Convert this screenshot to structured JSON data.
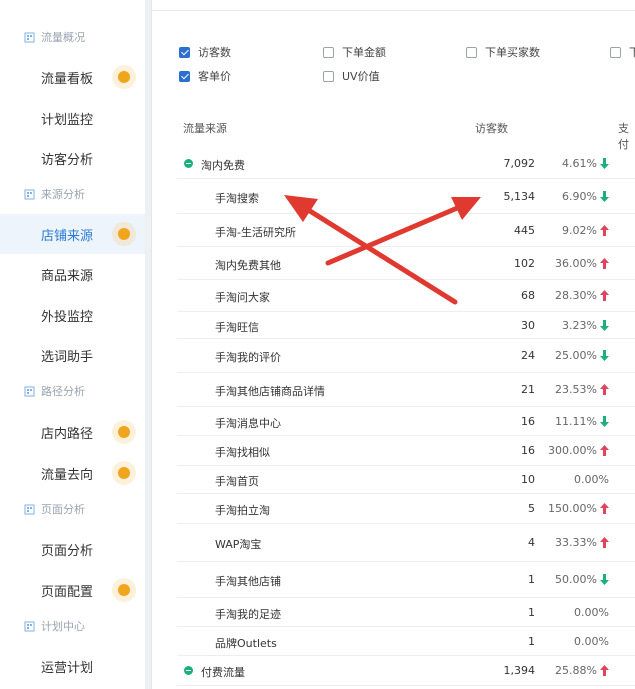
{
  "sidebar": {
    "sections": [
      {
        "label": "流量概况"
      },
      {
        "label": "来源分析"
      },
      {
        "label": "路径分析"
      },
      {
        "label": "页面分析"
      },
      {
        "label": "计划中心"
      }
    ],
    "items": [
      {
        "label": "流量看板"
      },
      {
        "label": "计划监控"
      },
      {
        "label": "访客分析"
      },
      {
        "label": "店铺来源"
      },
      {
        "label": "商品来源"
      },
      {
        "label": "外投监控"
      },
      {
        "label": "选词助手"
      },
      {
        "label": "店内路径"
      },
      {
        "label": "流量去向"
      },
      {
        "label": "页面分析"
      },
      {
        "label": "页面配置"
      },
      {
        "label": "运营计划"
      }
    ]
  },
  "metrics": [
    {
      "label": "访客数",
      "checked": true
    },
    {
      "label": "下单金额",
      "checked": false
    },
    {
      "label": "下单买家数",
      "checked": false
    },
    {
      "label": "下",
      "checked": false
    },
    {
      "label": "客单价",
      "checked": true
    },
    {
      "label": "UV价值",
      "checked": false
    }
  ],
  "table": {
    "headers": {
      "source": "流量来源",
      "visitors": "访客数",
      "extra": "支付"
    },
    "rows": [
      {
        "name": "淘内免费",
        "visitors": "7,092",
        "change": "4.61%",
        "trend": "down",
        "group": true
      },
      {
        "name": "手淘搜索",
        "visitors": "5,134",
        "change": "6.90%",
        "trend": "down"
      },
      {
        "name": "手淘-生活研究所",
        "visitors": "445",
        "change": "9.02%",
        "trend": "up"
      },
      {
        "name": "淘内免费其他",
        "visitors": "102",
        "change": "36.00%",
        "trend": "up"
      },
      {
        "name": "手淘问大家",
        "visitors": "68",
        "change": "28.30%",
        "trend": "up"
      },
      {
        "name": "手淘旺信",
        "visitors": "30",
        "change": "3.23%",
        "trend": "down"
      },
      {
        "name": "手淘我的评价",
        "visitors": "24",
        "change": "25.00%",
        "trend": "down"
      },
      {
        "name": "手淘其他店铺商品详情",
        "visitors": "21",
        "change": "23.53%",
        "trend": "up"
      },
      {
        "name": "手淘消息中心",
        "visitors": "16",
        "change": "11.11%",
        "trend": "down"
      },
      {
        "name": "手淘找相似",
        "visitors": "16",
        "change": "300.00%",
        "trend": "up"
      },
      {
        "name": "手淘首页",
        "visitors": "10",
        "change": "0.00%",
        "trend": "none"
      },
      {
        "name": "手淘拍立淘",
        "visitors": "5",
        "change": "150.00%",
        "trend": "up"
      },
      {
        "name": "WAP淘宝",
        "visitors": "4",
        "change": "33.33%",
        "trend": "up"
      },
      {
        "name": "手淘其他店铺",
        "visitors": "1",
        "change": "50.00%",
        "trend": "down"
      },
      {
        "name": "手淘我的足迹",
        "visitors": "1",
        "change": "0.00%",
        "trend": "none"
      },
      {
        "name": "品牌Outlets",
        "visitors": "1",
        "change": "0.00%",
        "trend": "none"
      },
      {
        "name": "付费流量",
        "visitors": "1,394",
        "change": "25.88%",
        "trend": "up",
        "group": true
      }
    ]
  },
  "colors": {
    "up": "#e0435b",
    "down": "#1bb07a",
    "accent": "#2b7bd6",
    "dot": "#f0a51c",
    "annotation": "#e0392f"
  }
}
